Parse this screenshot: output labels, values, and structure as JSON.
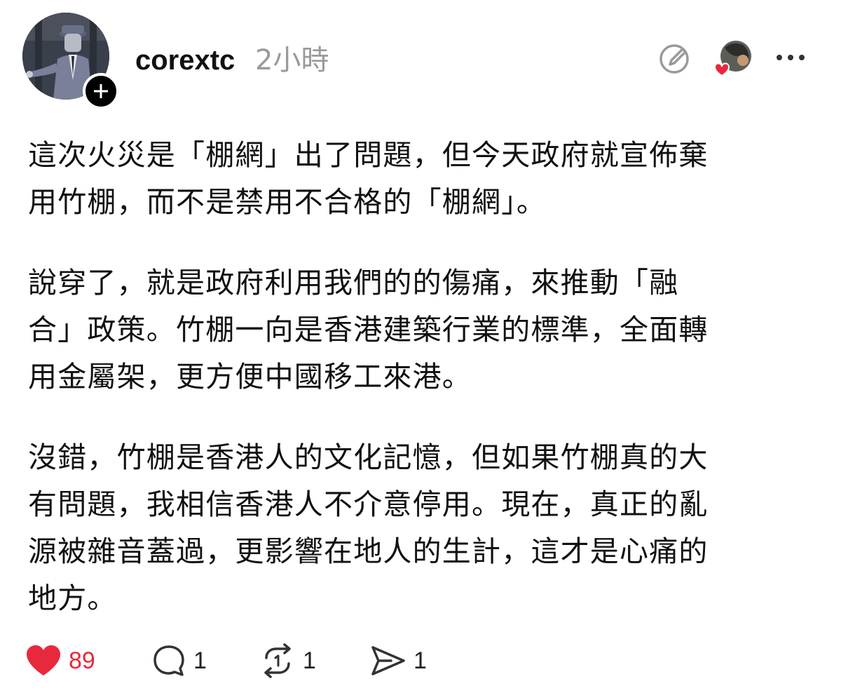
{
  "post": {
    "author": "corextc",
    "time": "2小時",
    "paragraphs": [
      "這次火災是「棚網」出了問題，但今天政府就宣佈棄用竹棚，而不是禁用不合格的「棚網」。",
      "說穿了，就是政府利用我們的的傷痛，來推動「融合」政策。竹棚一向是香港建築行業的標準，全面轉用金屬架，更方便中國移工來港。",
      "沒錯，竹棚是香港人的文化記憶，但如果竹棚真的大有問題，我相信香港人不介意停用。現在，真正的亂源被雜音蓋過，更影響在地人的生計，這才是心痛的地方。"
    ],
    "para_lines": [
      [
        "這次火災是「棚網」出了問題，但今天政府就宣佈棄",
        "用竹棚，而不是禁用不合格的「棚網」。"
      ],
      [
        "說穿了，就是政府利用我們的的傷痛，來推動「融",
        "合」政策。竹棚一向是香港建築行業的標準，全面轉",
        "用金屬架，更方便中國移工來港。"
      ],
      [
        "沒錯，竹棚是香港人的文化記憶，但如果竹棚真的大",
        "有問題，我相信香港人不介意停用。現在，真正的亂",
        "源被雜音蓋過，更影響在地人的生計，這才是心痛的",
        "地方。"
      ]
    ]
  },
  "actions": {
    "likes": "89",
    "replies": "1",
    "reposts": "1",
    "shares": "1"
  },
  "colors": {
    "like": "#e8283c",
    "muted": "#9a9a9a",
    "text": "#111111"
  },
  "icons": {
    "avatar": "user-avatar",
    "follow": "plus-icon",
    "edit": "edit-icon",
    "liker": "liker-avatar-with-heart",
    "more": "more-dots-icon",
    "like": "heart-icon",
    "reply": "comment-icon",
    "repost": "repost-icon",
    "share": "send-icon"
  }
}
